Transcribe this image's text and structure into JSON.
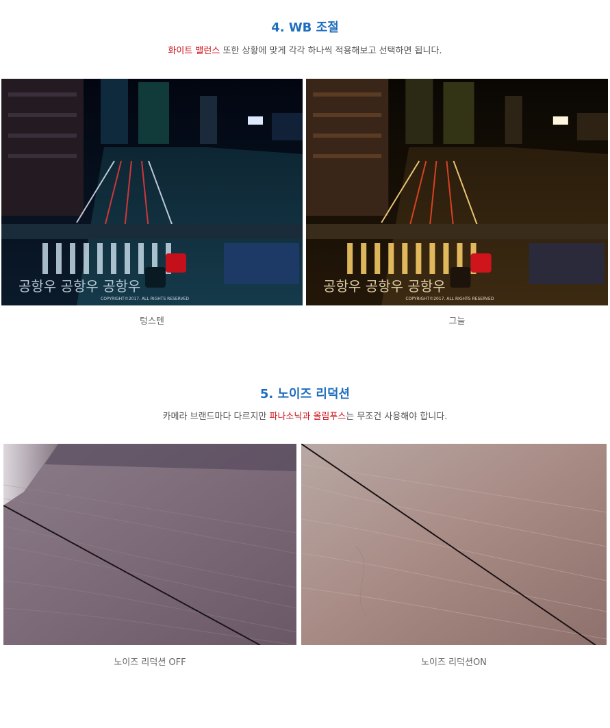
{
  "section4": {
    "title": "4. WB 조절",
    "desc_highlight": "화이트 밸런스",
    "desc_rest": " 또한 상황에 맞게 각각 하나씩 적용해보고 선택하면 됩니다.",
    "photos": [
      {
        "caption": "텅스텐",
        "watermark": "COPYRIGHT©2017. ALL RIGHTS RESERVED",
        "road_text": "공항우 공항우 공항우"
      },
      {
        "caption": "그늘",
        "watermark": "COPYRIGHT©2017. ALL RIGHTS RESERVED",
        "road_text": "공항우 공항우 공항우"
      }
    ]
  },
  "section5": {
    "title": "5. 노이즈 리덕션",
    "desc_before": "카메라 브랜드마다 다르지만 ",
    "desc_highlight": "파나소닉과 올림푸스",
    "desc_after": "는 무조건 사용해야 합니다.",
    "photos": [
      {
        "caption": "노이즈 리덕션 OFF"
      },
      {
        "caption": "노이즈 리덕션ON"
      }
    ]
  },
  "colors": {
    "title": "#1f6dbd",
    "highlight": "#d0121b",
    "body_text": "#555555"
  }
}
